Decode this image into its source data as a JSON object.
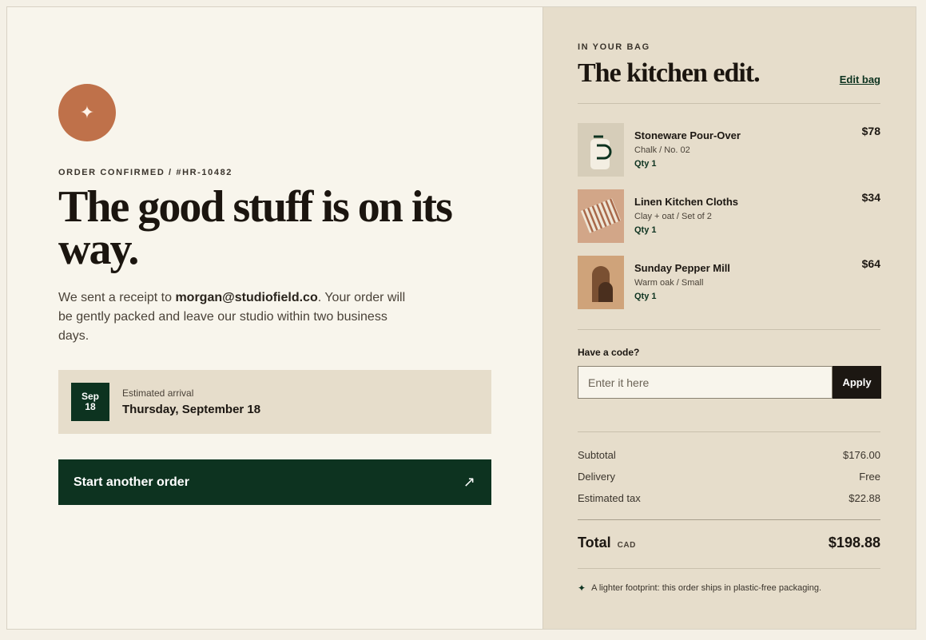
{
  "confirmation": {
    "badge_icon": "✦",
    "eyebrow": "ORDER CONFIRMED / #HR-10482",
    "headline": "The good stuff is on its way.",
    "lede_prefix": "We sent a receipt to ",
    "email": "morgan@studiofield.co",
    "lede_suffix": ". Your order will be gently packed and leave our studio within two business days.",
    "arrival": {
      "month": "Sep",
      "day": "18",
      "label": "Estimated arrival",
      "date": "Thursday, September 18"
    },
    "cta": {
      "label": "Start another order",
      "icon": "↗"
    }
  },
  "bag": {
    "eyebrow": "IN YOUR BAG",
    "title": "The kitchen edit.",
    "edit_label": "Edit bag",
    "items": [
      {
        "name": "Stoneware Pour-Over",
        "variant": "Chalk / No. 02",
        "qty": "Qty 1",
        "price": "$78",
        "thumb_color": "#d6cdb9"
      },
      {
        "name": "Linen Kitchen Cloths",
        "variant": "Clay + oat / Set of 2",
        "qty": "Qty 1",
        "price": "$34",
        "thumb_color": "#d2a688"
      },
      {
        "name": "Sunday Pepper Mill",
        "variant": "Warm oak / Small",
        "qty": "Qty 1",
        "price": "$64",
        "thumb_color": "#cfa37a"
      }
    ],
    "promo": {
      "label": "Have a code?",
      "placeholder": "Enter it here",
      "apply_label": "Apply"
    },
    "summary": {
      "subtotal_label": "Subtotal",
      "subtotal_value": "$176.00",
      "delivery_label": "Delivery",
      "delivery_value": "Free",
      "tax_label": "Estimated tax",
      "tax_value": "$22.88"
    },
    "total": {
      "label": "Total",
      "currency": "CAD",
      "value": "$198.88"
    },
    "footnote_icon": "✦",
    "footnote": "A lighter footprint: this order ships in plastic-free packaging."
  },
  "colors": {
    "accent_green": "#0d3320",
    "badge_clay": "#bf714a",
    "left_bg": "#f8f5ec",
    "right_bg": "#e6ddcb"
  }
}
